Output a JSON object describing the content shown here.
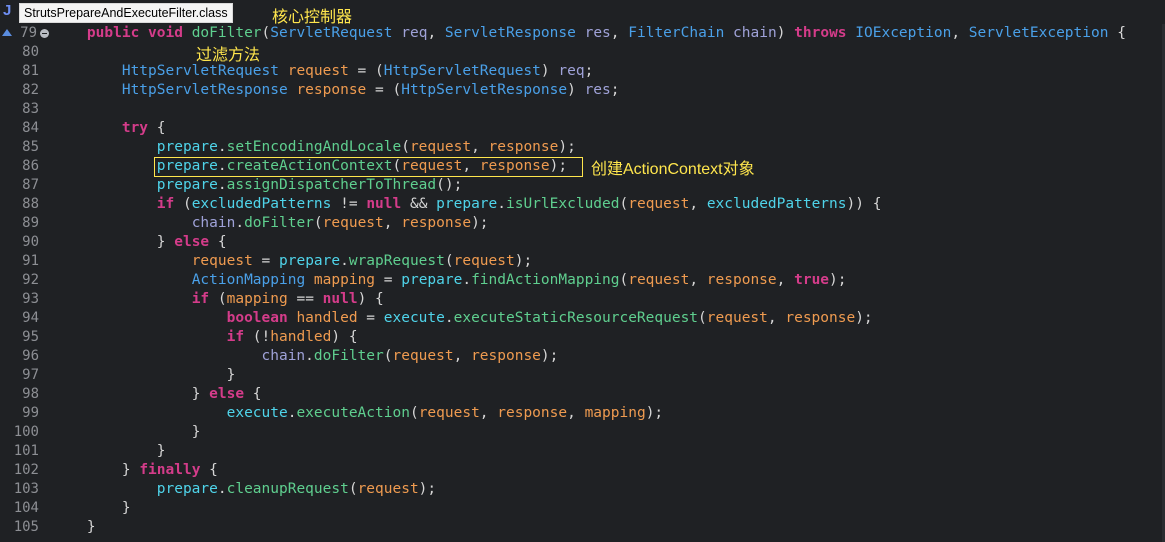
{
  "tab": {
    "filename": "StrutsPrepareAndExecuteFilter.class",
    "icon": "java-class-icon",
    "glyph": "J"
  },
  "annotations": {
    "core_controller": "核心控制器",
    "filter_method": "过滤方法",
    "create_context": "创建ActionContext对象"
  },
  "colors": {
    "background": "#1f2124",
    "keyword": "#d43c8a",
    "type": "#4aa0e8",
    "method": "#5fcf8f",
    "variable": "#ef9b50",
    "parameter": "#9fa2d8",
    "field": "#4fd4ea",
    "annotation": "#ffe64d"
  },
  "lines": [
    {
      "n": "79",
      "marker": "override",
      "fold": true,
      "tokens": [
        [
          "    ",
          "txt"
        ],
        [
          "public",
          "kw"
        ],
        [
          " ",
          "txt"
        ],
        [
          "void",
          "kw"
        ],
        [
          " ",
          "txt"
        ],
        [
          "doFilter",
          "mt"
        ],
        [
          "(",
          "txt"
        ],
        [
          "ServletRequest",
          "ty"
        ],
        [
          " ",
          "txt"
        ],
        [
          "req",
          "par"
        ],
        [
          ", ",
          "txt"
        ],
        [
          "ServletResponse",
          "ty"
        ],
        [
          " ",
          "txt"
        ],
        [
          "res",
          "par"
        ],
        [
          ", ",
          "txt"
        ],
        [
          "FilterChain",
          "ty"
        ],
        [
          " ",
          "txt"
        ],
        [
          "chain",
          "par"
        ],
        [
          ") ",
          "txt"
        ],
        [
          "throws",
          "kw"
        ],
        [
          " ",
          "txt"
        ],
        [
          "IOException",
          "ty"
        ],
        [
          ", ",
          "txt"
        ],
        [
          "ServletException",
          "ty"
        ],
        [
          " {",
          "txt"
        ]
      ]
    },
    {
      "n": "80",
      "tokens": []
    },
    {
      "n": "81",
      "tokens": [
        [
          "        ",
          "txt"
        ],
        [
          "HttpServletRequest",
          "ty"
        ],
        [
          " ",
          "txt"
        ],
        [
          "request",
          "var"
        ],
        [
          " = (",
          "txt"
        ],
        [
          "HttpServletRequest",
          "ty"
        ],
        [
          ") ",
          "txt"
        ],
        [
          "req",
          "par"
        ],
        [
          ";",
          "txt"
        ]
      ]
    },
    {
      "n": "82",
      "tokens": [
        [
          "        ",
          "txt"
        ],
        [
          "HttpServletResponse",
          "ty"
        ],
        [
          " ",
          "txt"
        ],
        [
          "response",
          "var"
        ],
        [
          " = (",
          "txt"
        ],
        [
          "HttpServletResponse",
          "ty"
        ],
        [
          ") ",
          "txt"
        ],
        [
          "res",
          "par"
        ],
        [
          ";",
          "txt"
        ]
      ]
    },
    {
      "n": "83",
      "tokens": []
    },
    {
      "n": "84",
      "tokens": [
        [
          "        ",
          "txt"
        ],
        [
          "try",
          "kw"
        ],
        [
          " {",
          "txt"
        ]
      ]
    },
    {
      "n": "85",
      "tokens": [
        [
          "            ",
          "txt"
        ],
        [
          "prepare",
          "fld"
        ],
        [
          ".",
          "txt"
        ],
        [
          "setEncodingAndLocale",
          "mt"
        ],
        [
          "(",
          "txt"
        ],
        [
          "request",
          "var"
        ],
        [
          ", ",
          "txt"
        ],
        [
          "response",
          "var"
        ],
        [
          ");",
          "txt"
        ]
      ]
    },
    {
      "n": "86",
      "tokens": [
        [
          "            ",
          "txt"
        ],
        [
          "prepare",
          "fld"
        ],
        [
          ".",
          "txt"
        ],
        [
          "createActionContext",
          "mt"
        ],
        [
          "(",
          "txt"
        ],
        [
          "request",
          "var"
        ],
        [
          ", ",
          "txt"
        ],
        [
          "response",
          "var"
        ],
        [
          ");",
          "txt"
        ]
      ]
    },
    {
      "n": "87",
      "tokens": [
        [
          "            ",
          "txt"
        ],
        [
          "prepare",
          "fld"
        ],
        [
          ".",
          "txt"
        ],
        [
          "assignDispatcherToThread",
          "mt"
        ],
        [
          "();",
          "txt"
        ]
      ]
    },
    {
      "n": "88",
      "tokens": [
        [
          "            ",
          "txt"
        ],
        [
          "if",
          "kw"
        ],
        [
          " (",
          "txt"
        ],
        [
          "excludedPatterns",
          "fld"
        ],
        [
          " != ",
          "txt"
        ],
        [
          "null",
          "kw"
        ],
        [
          " && ",
          "txt"
        ],
        [
          "prepare",
          "fld"
        ],
        [
          ".",
          "txt"
        ],
        [
          "isUrlExcluded",
          "mt"
        ],
        [
          "(",
          "txt"
        ],
        [
          "request",
          "var"
        ],
        [
          ", ",
          "txt"
        ],
        [
          "excludedPatterns",
          "fld"
        ],
        [
          ")) {",
          "txt"
        ]
      ]
    },
    {
      "n": "89",
      "tokens": [
        [
          "                ",
          "txt"
        ],
        [
          "chain",
          "par"
        ],
        [
          ".",
          "txt"
        ],
        [
          "doFilter",
          "mt"
        ],
        [
          "(",
          "txt"
        ],
        [
          "request",
          "var"
        ],
        [
          ", ",
          "txt"
        ],
        [
          "response",
          "var"
        ],
        [
          ");",
          "txt"
        ]
      ]
    },
    {
      "n": "90",
      "tokens": [
        [
          "            ",
          "txt"
        ],
        [
          "} ",
          "txt"
        ],
        [
          "else",
          "kw"
        ],
        [
          " {",
          "txt"
        ]
      ]
    },
    {
      "n": "91",
      "tokens": [
        [
          "                ",
          "txt"
        ],
        [
          "request",
          "var"
        ],
        [
          " = ",
          "txt"
        ],
        [
          "prepare",
          "fld"
        ],
        [
          ".",
          "txt"
        ],
        [
          "wrapRequest",
          "mt"
        ],
        [
          "(",
          "txt"
        ],
        [
          "request",
          "var"
        ],
        [
          ");",
          "txt"
        ]
      ]
    },
    {
      "n": "92",
      "tokens": [
        [
          "                ",
          "txt"
        ],
        [
          "ActionMapping",
          "ty"
        ],
        [
          " ",
          "txt"
        ],
        [
          "mapping",
          "var"
        ],
        [
          " = ",
          "txt"
        ],
        [
          "prepare",
          "fld"
        ],
        [
          ".",
          "txt"
        ],
        [
          "findActionMapping",
          "mt"
        ],
        [
          "(",
          "txt"
        ],
        [
          "request",
          "var"
        ],
        [
          ", ",
          "txt"
        ],
        [
          "response",
          "var"
        ],
        [
          ", ",
          "txt"
        ],
        [
          "true",
          "kw"
        ],
        [
          ");",
          "txt"
        ]
      ]
    },
    {
      "n": "93",
      "tokens": [
        [
          "                ",
          "txt"
        ],
        [
          "if",
          "kw"
        ],
        [
          " (",
          "txt"
        ],
        [
          "mapping",
          "var"
        ],
        [
          " == ",
          "txt"
        ],
        [
          "null",
          "kw"
        ],
        [
          ") {",
          "txt"
        ]
      ]
    },
    {
      "n": "94",
      "tokens": [
        [
          "                    ",
          "txt"
        ],
        [
          "boolean",
          "kw"
        ],
        [
          " ",
          "txt"
        ],
        [
          "handled",
          "var"
        ],
        [
          " = ",
          "txt"
        ],
        [
          "execute",
          "fld"
        ],
        [
          ".",
          "txt"
        ],
        [
          "executeStaticResourceRequest",
          "mt"
        ],
        [
          "(",
          "txt"
        ],
        [
          "request",
          "var"
        ],
        [
          ", ",
          "txt"
        ],
        [
          "response",
          "var"
        ],
        [
          ");",
          "txt"
        ]
      ]
    },
    {
      "n": "95",
      "tokens": [
        [
          "                    ",
          "txt"
        ],
        [
          "if",
          "kw"
        ],
        [
          " (!",
          "txt"
        ],
        [
          "handled",
          "var"
        ],
        [
          ") {",
          "txt"
        ]
      ]
    },
    {
      "n": "96",
      "tokens": [
        [
          "                        ",
          "txt"
        ],
        [
          "chain",
          "par"
        ],
        [
          ".",
          "txt"
        ],
        [
          "doFilter",
          "mt"
        ],
        [
          "(",
          "txt"
        ],
        [
          "request",
          "var"
        ],
        [
          ", ",
          "txt"
        ],
        [
          "response",
          "var"
        ],
        [
          ");",
          "txt"
        ]
      ]
    },
    {
      "n": "97",
      "tokens": [
        [
          "                    ",
          "txt"
        ],
        [
          "}",
          "txt"
        ]
      ]
    },
    {
      "n": "98",
      "tokens": [
        [
          "                ",
          "txt"
        ],
        [
          "} ",
          "txt"
        ],
        [
          "else",
          "kw"
        ],
        [
          " {",
          "txt"
        ]
      ]
    },
    {
      "n": "99",
      "tokens": [
        [
          "                    ",
          "txt"
        ],
        [
          "execute",
          "fld"
        ],
        [
          ".",
          "txt"
        ],
        [
          "executeAction",
          "mt"
        ],
        [
          "(",
          "txt"
        ],
        [
          "request",
          "var"
        ],
        [
          ", ",
          "txt"
        ],
        [
          "response",
          "var"
        ],
        [
          ", ",
          "txt"
        ],
        [
          "mapping",
          "var"
        ],
        [
          ");",
          "txt"
        ]
      ]
    },
    {
      "n": "100",
      "tokens": [
        [
          "                ",
          "txt"
        ],
        [
          "}",
          "txt"
        ]
      ]
    },
    {
      "n": "101",
      "tokens": [
        [
          "            ",
          "txt"
        ],
        [
          "}",
          "txt"
        ]
      ]
    },
    {
      "n": "102",
      "tokens": [
        [
          "        ",
          "txt"
        ],
        [
          "} ",
          "txt"
        ],
        [
          "finally",
          "kw"
        ],
        [
          " {",
          "txt"
        ]
      ]
    },
    {
      "n": "103",
      "tokens": [
        [
          "            ",
          "txt"
        ],
        [
          "prepare",
          "fld"
        ],
        [
          ".",
          "txt"
        ],
        [
          "cleanupRequest",
          "mt"
        ],
        [
          "(",
          "txt"
        ],
        [
          "request",
          "var"
        ],
        [
          ");",
          "txt"
        ]
      ]
    },
    {
      "n": "104",
      "tokens": [
        [
          "        ",
          "txt"
        ],
        [
          "}",
          "txt"
        ]
      ]
    },
    {
      "n": "105",
      "tokens": [
        [
          "    ",
          "txt"
        ],
        [
          "}",
          "txt"
        ]
      ]
    }
  ]
}
